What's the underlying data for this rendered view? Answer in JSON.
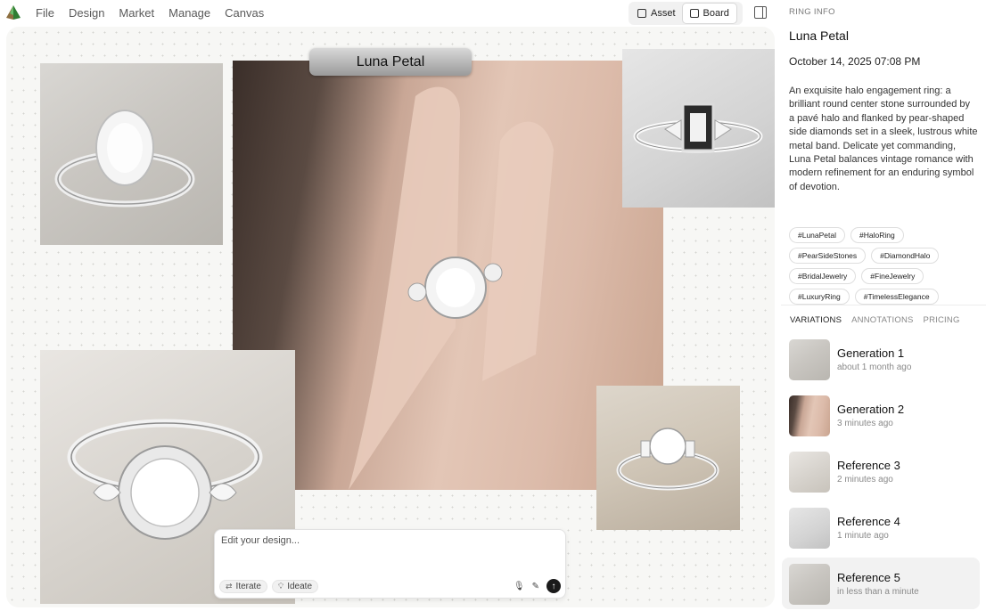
{
  "menu": [
    "File",
    "Design",
    "Market",
    "Manage",
    "Canvas"
  ],
  "view_toggle": {
    "asset": "Asset",
    "board": "Board"
  },
  "canvas": {
    "title_chip": "Luna Petal",
    "prompt": {
      "placeholder": "Edit your design...",
      "iterate": "Iterate",
      "ideate": "Ideate"
    }
  },
  "sidebar": {
    "heading": "RING INFO",
    "title": "Luna Petal",
    "date": "October 14, 2025 07:08 PM",
    "description": "An exquisite halo engagement ring: a brilliant round center stone surrounded by a pavé halo and flanked by pear-shaped side diamonds set in a sleek, lustrous white metal band. Delicate yet commanding, Luna Petal balances vintage romance with modern refinement for an enduring symbol of devotion.",
    "tags": [
      "#LunaPetal",
      "#HaloRing",
      "#PearSideStones",
      "#DiamondHalo",
      "#BridalJewelry",
      "#FineJewelry",
      "#LuxuryRing",
      "#TimelessElegance"
    ],
    "tabs": [
      "VARIATIONS",
      "ANNOTATIONS",
      "PRICING"
    ],
    "variations": [
      {
        "name": "Generation 1",
        "time": "about 1 month ago"
      },
      {
        "name": "Generation 2",
        "time": "3 minutes ago"
      },
      {
        "name": "Reference 3",
        "time": "2 minutes ago"
      },
      {
        "name": "Reference 4",
        "time": "1 minute ago"
      },
      {
        "name": "Reference 5",
        "time": "in less than a minute"
      }
    ]
  },
  "icons": {
    "logo": "green-pyramid-logo",
    "asset": "asset-icon",
    "board": "board-icon",
    "panel": "sidebar-toggle-icon",
    "iterate": "iterate-icon",
    "ideate": "lightbulb-icon",
    "mic": "microphone-icon",
    "pen": "pen-icon",
    "send": "arrow-up-icon"
  }
}
